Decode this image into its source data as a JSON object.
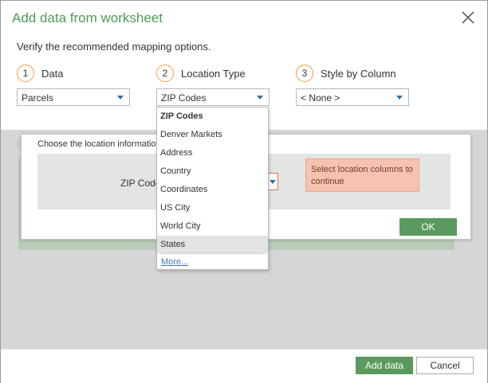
{
  "dialog": {
    "title": "Add data from worksheet",
    "subtitle": "Verify the recommended mapping options."
  },
  "steps": [
    {
      "num": "1",
      "label": "Data",
      "value": "Parcels"
    },
    {
      "num": "2",
      "label": "Location Type",
      "value": "ZIP Codes"
    },
    {
      "num": "3",
      "label": "Style by Column",
      "value": "< None >"
    }
  ],
  "location_panel": {
    "title": "Choose the location information",
    "field_label": "ZIP Code",
    "warning": "Select location columns to continue",
    "ok_label": "OK",
    "background_label": "C"
  },
  "dropdown": {
    "options": [
      "ZIP Codes",
      "Denver Markets",
      "Address",
      "Country",
      "Coordinates",
      "US City",
      "World City",
      "States"
    ],
    "selected": "ZIP Codes",
    "highlighted": "States",
    "more_label": "More..."
  },
  "footer": {
    "add_label": "Add data",
    "cancel_label": "Cancel"
  },
  "colors": {
    "accent_green": "#5b9a5e",
    "title_green": "#4d9a56",
    "step_circle": "#f0a040",
    "warning_bg": "#f5c3b0",
    "link": "#3b79b6"
  }
}
